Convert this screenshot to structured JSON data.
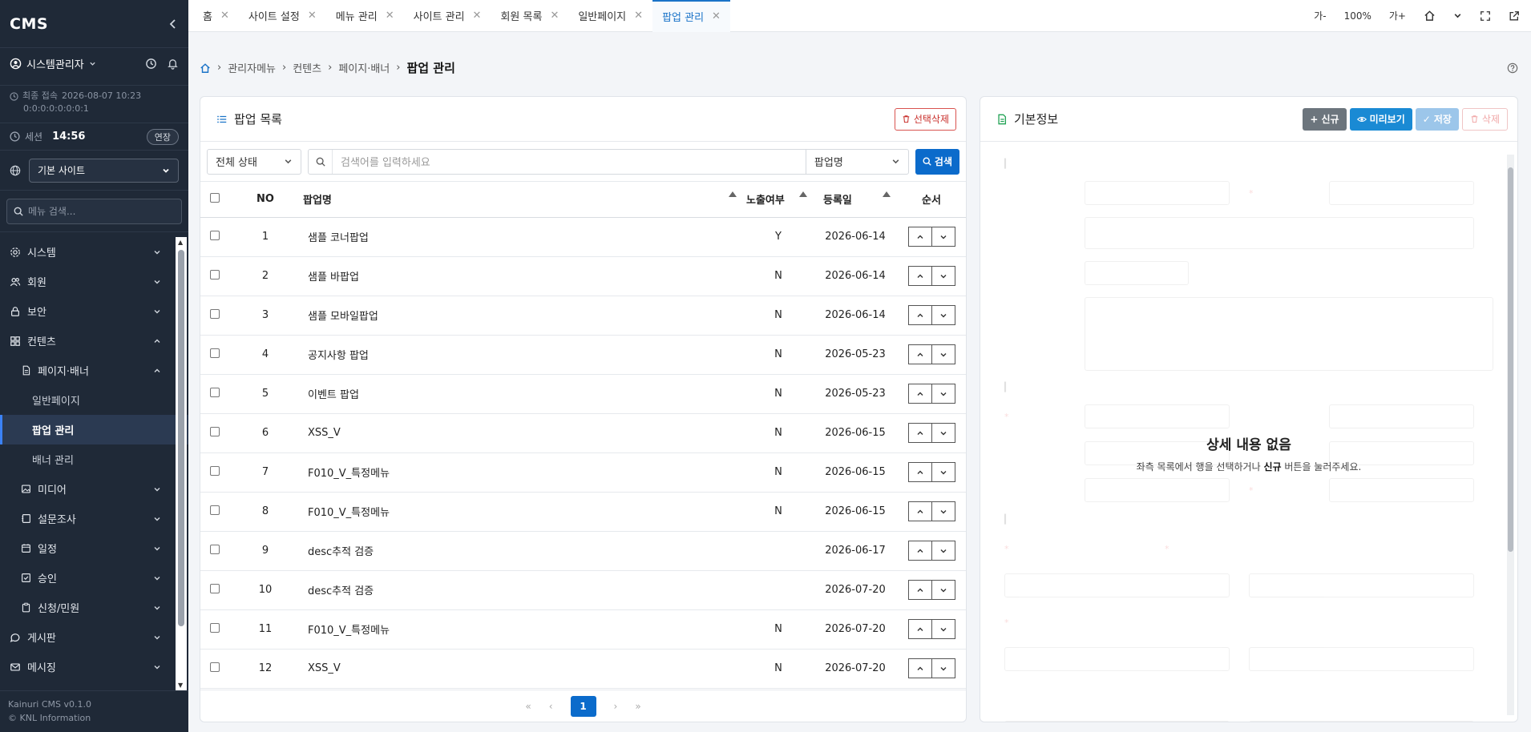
{
  "app": {
    "logo": "CMS"
  },
  "user": {
    "name": "시스템관리자",
    "last_login_label": "최종 접속",
    "last_login_time": "2026-08-07 10:23",
    "ip": "0:0:0:0:0:0:0:1"
  },
  "session": {
    "label": "세션",
    "time": "14:56",
    "extend_label": "연장"
  },
  "site": {
    "selected": "기본 사이트"
  },
  "menu_search": {
    "placeholder": "메뉴 검색..."
  },
  "menu": {
    "system": "시스템",
    "member": "회원",
    "security": "보안",
    "contents": "컨텐츠",
    "page_banner": "페이지·배너",
    "general_page": "일반페이지",
    "popup_mgmt": "팝업 관리",
    "banner_mgmt": "배너 관리",
    "media": "미디어",
    "survey": "설문조사",
    "schedule": "일정",
    "approval": "승인",
    "application": "신청/민원",
    "board": "게시판",
    "messaging": "메시징"
  },
  "footer": {
    "version": "Kainuri CMS v0.1.0",
    "copyright": "© KNL Information"
  },
  "tabs": [
    "홈",
    "사이트 설정",
    "메뉴 관리",
    "사이트 관리",
    "회원 목록",
    "일반페이지",
    "팝업 관리"
  ],
  "top_controls": {
    "font_down": "가-",
    "zoom": "100%",
    "font_up": "가+"
  },
  "breadcrumb": {
    "root": "관리자메뉴",
    "level1": "컨텐츠",
    "level2": "페이지·배너",
    "current": "팝업 관리"
  },
  "list_panel": {
    "title": "팝업 목록",
    "delete_selected": "선택삭제",
    "status_filter": "전체 상태",
    "search_placeholder": "검색어를 입력하세요",
    "search_field": "팝업명",
    "search_button": "검색",
    "columns": {
      "no": "NO",
      "name": "팝업명",
      "exposure": "노출여부",
      "date": "등록일",
      "order": "순서"
    },
    "rows": [
      {
        "no": "1",
        "name": "샘플 코너팝업",
        "exposure": "Y",
        "date": "2026-06-14"
      },
      {
        "no": "2",
        "name": "샘플 바팝업",
        "exposure": "N",
        "date": "2026-06-14"
      },
      {
        "no": "3",
        "name": "샘플 모바일팝업",
        "exposure": "N",
        "date": "2026-06-14"
      },
      {
        "no": "4",
        "name": "공지사항 팝업",
        "exposure": "N",
        "date": "2026-05-23"
      },
      {
        "no": "5",
        "name": "이벤트 팝업",
        "exposure": "N",
        "date": "2026-05-23"
      },
      {
        "no": "6",
        "name": "XSS_V",
        "exposure": "N",
        "date": "2026-06-15"
      },
      {
        "no": "7",
        "name": "F010_V_특정메뉴",
        "exposure": "N",
        "date": "2026-06-15"
      },
      {
        "no": "8",
        "name": "F010_V_특정메뉴",
        "exposure": "N",
        "date": "2026-06-15"
      },
      {
        "no": "9",
        "name": "desc추적 검증",
        "exposure": "",
        "date": "2026-06-17"
      },
      {
        "no": "10",
        "name": "desc추적 검증",
        "exposure": "",
        "date": "2026-07-20"
      },
      {
        "no": "11",
        "name": "F010_V_특정메뉴",
        "exposure": "N",
        "date": "2026-07-20"
      },
      {
        "no": "12",
        "name": "XSS_V",
        "exposure": "N",
        "date": "2026-07-20"
      }
    ],
    "pagination": {
      "first": "«",
      "prev": "‹",
      "current": "1",
      "next": "›",
      "last": "»"
    }
  },
  "detail_panel": {
    "title": "기본정보",
    "new_label": "신규",
    "preview_label": "미리보기",
    "save_label": "저장",
    "delete_label": "삭제",
    "empty_title": "상세 내용 없음",
    "empty_prefix": "좌측 목록에서 행을 선택하거나",
    "empty_emphasis": "신규",
    "empty_suffix": "버튼을 눌러주세요."
  },
  "colors": {
    "sidebar_bg": "#1f2937",
    "primary": "#0b6bcb",
    "active_tab": "#1a73c8",
    "danger": "#d9534f"
  }
}
